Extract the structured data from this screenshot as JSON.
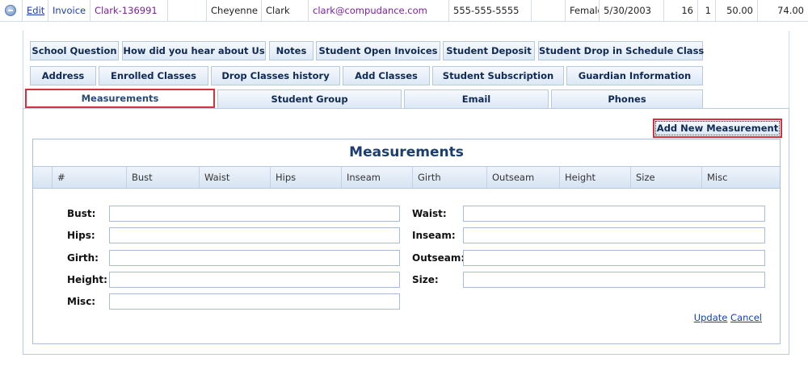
{
  "student_row": {
    "edit_link": "Edit",
    "invoice_link": "Invoice",
    "student_id": "Clark-136991",
    "first_name": "Cheyenne",
    "last_name": "Clark",
    "email": "clark@compudance.com",
    "phone": "555-555-5555",
    "gender": "Female",
    "birth_date": "5/30/2003",
    "col_a": "16",
    "col_b": "1",
    "col_c": "50.00",
    "col_d": "74.00"
  },
  "tabs": {
    "row1": [
      "School Question",
      "How did you hear about Us",
      "Notes",
      "Student Open Invoices",
      "Student Deposit",
      "Student Drop in Schedule Class"
    ],
    "row2": [
      "Address",
      "Enrolled Classes",
      "Drop Classes history",
      "Add Classes",
      "Student Subscription",
      "Guardian Information"
    ],
    "row3": [
      "Measurements",
      "Student Group",
      "Email",
      "Phones"
    ],
    "selected": "Measurements"
  },
  "toolbar": {
    "add_label": "Add New Measurement"
  },
  "grid": {
    "title": "Measurements",
    "columns": [
      "#",
      "Bust",
      "Waist",
      "Hips",
      "Inseam",
      "Girth",
      "Outseam",
      "Height",
      "Size",
      "Misc"
    ]
  },
  "form": {
    "bust_label": "Bust:",
    "waist_label": "Waist:",
    "hips_label": "Hips:",
    "inseam_label": "Inseam:",
    "girth_label": "Girth:",
    "outseam_label": "Outseam:",
    "height_label": "Height:",
    "size_label": "Size:",
    "misc_label": "Misc:",
    "values": {
      "bust": "",
      "waist": "",
      "hips": "",
      "inseam": "",
      "girth": "",
      "outseam": "",
      "height": "",
      "size": "",
      "misc": ""
    }
  },
  "actions": {
    "update": "Update",
    "cancel": "Cancel"
  },
  "colors": {
    "accent": "#dd2d3c",
    "link": "#1c3bb5",
    "header_text": "#102a55"
  }
}
